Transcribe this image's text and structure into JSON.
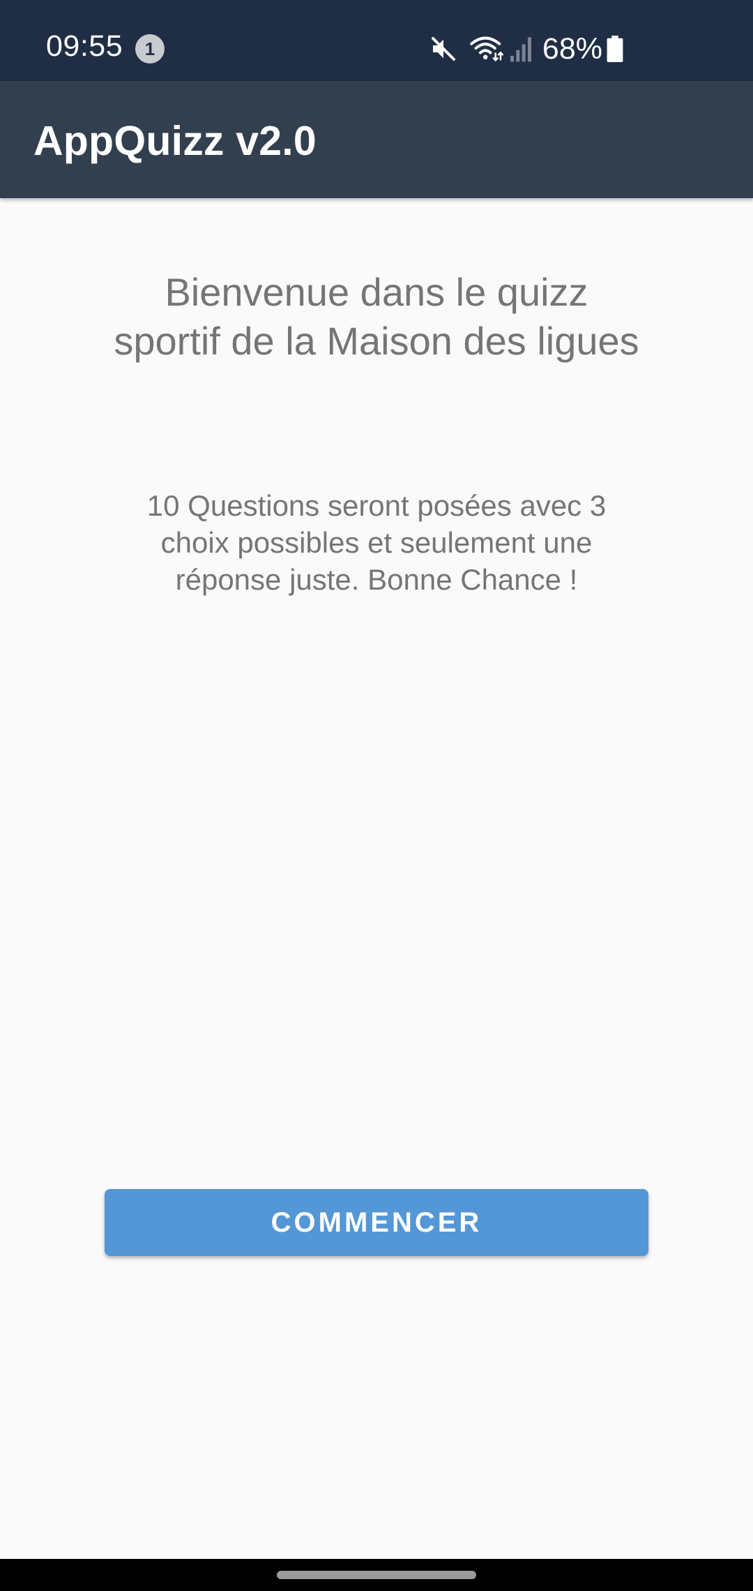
{
  "status_bar": {
    "time": "09:55",
    "notification_count": "1",
    "battery_percent": "68%",
    "icons": [
      "mute-icon",
      "wifi-icon",
      "signal-icon",
      "battery-icon"
    ]
  },
  "app_bar": {
    "title": "AppQuizz v2.0"
  },
  "main": {
    "welcome_title": "Bienvenue dans le quizz sportif de la Maison des ligues",
    "description": "10 Questions seront posées avec 3 choix possibles et seulement une réponse juste. Bonne Chance !",
    "start_button_label": "COMMENCER"
  },
  "colors": {
    "status_bar_bg": "#1f2d45",
    "app_bar_bg": "#323f4f",
    "page_bg": "#fafafa",
    "button_bg": "#5497d6",
    "text_gray": "#757575"
  }
}
